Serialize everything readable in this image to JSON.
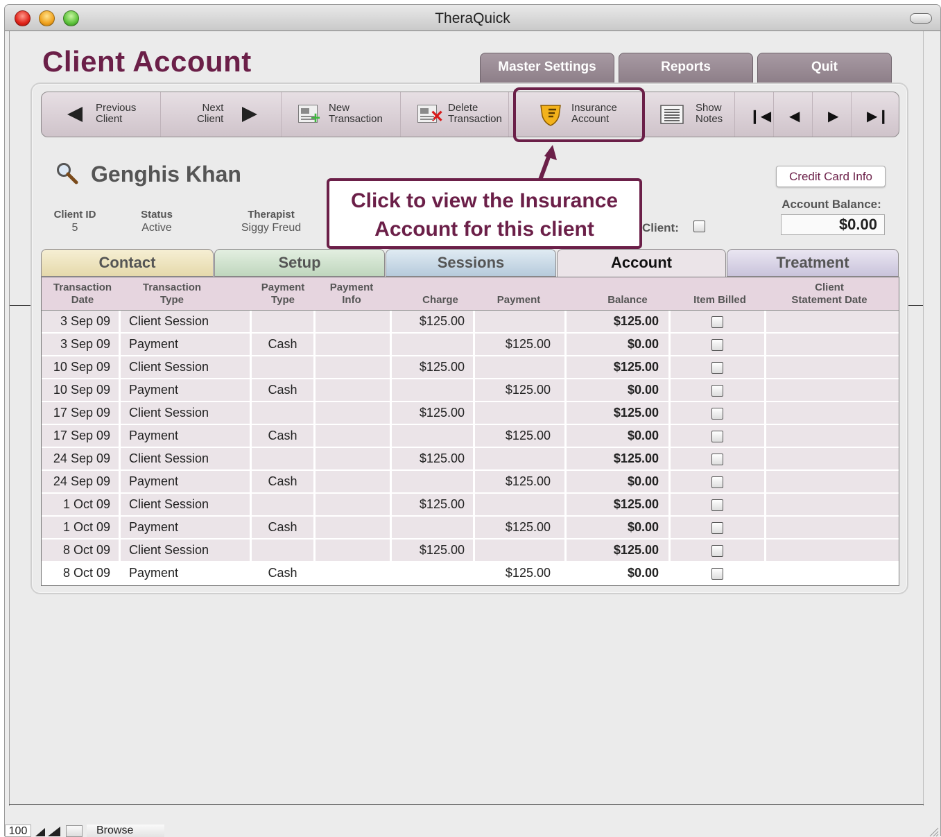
{
  "window": {
    "title": "TheraQuick"
  },
  "page": {
    "title": "Client Account"
  },
  "top_tabs": [
    "Master Settings",
    "Reports",
    "Quit"
  ],
  "toolbar": {
    "prev_client": [
      "Previous",
      "Client"
    ],
    "next_client": [
      "Next",
      "Client"
    ],
    "new_transaction": [
      "New",
      "Transaction"
    ],
    "delete_transaction": [
      "Delete",
      "Transaction"
    ],
    "insurance_account": [
      "Insurance",
      "Account"
    ],
    "show_notes": [
      "Show",
      "Notes"
    ]
  },
  "callout": {
    "line1": "Click to view the Insurance",
    "line2": "Account for this client"
  },
  "client": {
    "name": "Genghis Khan",
    "id_label": "Client ID",
    "id_value": "5",
    "status_label": "Status",
    "status_value": "Active",
    "therapist_label": "Therapist",
    "therapist_value": "Siggy Freud",
    "client_label": "Client:",
    "credit_card_button": "Credit Card Info",
    "balance_label": "Account Balance:",
    "balance_value": "$0.00"
  },
  "tabs": [
    "Contact",
    "Setup",
    "Sessions",
    "Account",
    "Treatment"
  ],
  "tab_colors": {
    "contact": "#efe6c4",
    "setup": "#cfe3cf",
    "sessions": "#cadbe8",
    "account": "#ebe4e8",
    "treatment": "#d8d4e6"
  },
  "table": {
    "headers": {
      "date": [
        "Transaction",
        "Date"
      ],
      "type": [
        "Transaction",
        "Type"
      ],
      "paytype": [
        "Payment",
        "Type"
      ],
      "payinfo": [
        "Payment",
        "Info"
      ],
      "charge": "Charge",
      "payment": "Payment",
      "balance": "Balance",
      "billed": "Item Billed",
      "stmt": [
        "Client",
        "Statement Date"
      ]
    },
    "rows": [
      {
        "date": "3 Sep 09",
        "type": "Client Session",
        "paytype": "",
        "charge": "$125.00",
        "payment": "",
        "balance": "$125.00"
      },
      {
        "date": "3 Sep 09",
        "type": "Payment",
        "paytype": "Cash",
        "charge": "",
        "payment": "$125.00",
        "balance": "$0.00"
      },
      {
        "date": "10 Sep 09",
        "type": "Client Session",
        "paytype": "",
        "charge": "$125.00",
        "payment": "",
        "balance": "$125.00"
      },
      {
        "date": "10 Sep 09",
        "type": "Payment",
        "paytype": "Cash",
        "charge": "",
        "payment": "$125.00",
        "balance": "$0.00"
      },
      {
        "date": "17 Sep 09",
        "type": "Client Session",
        "paytype": "",
        "charge": "$125.00",
        "payment": "",
        "balance": "$125.00"
      },
      {
        "date": "17 Sep 09",
        "type": "Payment",
        "paytype": "Cash",
        "charge": "",
        "payment": "$125.00",
        "balance": "$0.00"
      },
      {
        "date": "24 Sep 09",
        "type": "Client Session",
        "paytype": "",
        "charge": "$125.00",
        "payment": "",
        "balance": "$125.00"
      },
      {
        "date": "24 Sep 09",
        "type": "Payment",
        "paytype": "Cash",
        "charge": "",
        "payment": "$125.00",
        "balance": "$0.00"
      },
      {
        "date": "1 Oct 09",
        "type": "Client Session",
        "paytype": "",
        "charge": "$125.00",
        "payment": "",
        "balance": "$125.00"
      },
      {
        "date": "1 Oct 09",
        "type": "Payment",
        "paytype": "Cash",
        "charge": "",
        "payment": "$125.00",
        "balance": "$0.00"
      },
      {
        "date": "8 Oct 09",
        "type": "Client Session",
        "paytype": "",
        "charge": "$125.00",
        "payment": "",
        "balance": "$125.00"
      },
      {
        "date": "8 Oct 09",
        "type": "Payment",
        "paytype": "Cash",
        "charge": "",
        "payment": "$125.00",
        "balance": "$0.00"
      }
    ]
  },
  "statusbar": {
    "zoom": "100",
    "mode": "Browse"
  },
  "colors": {
    "accent": "#6b1f48"
  }
}
